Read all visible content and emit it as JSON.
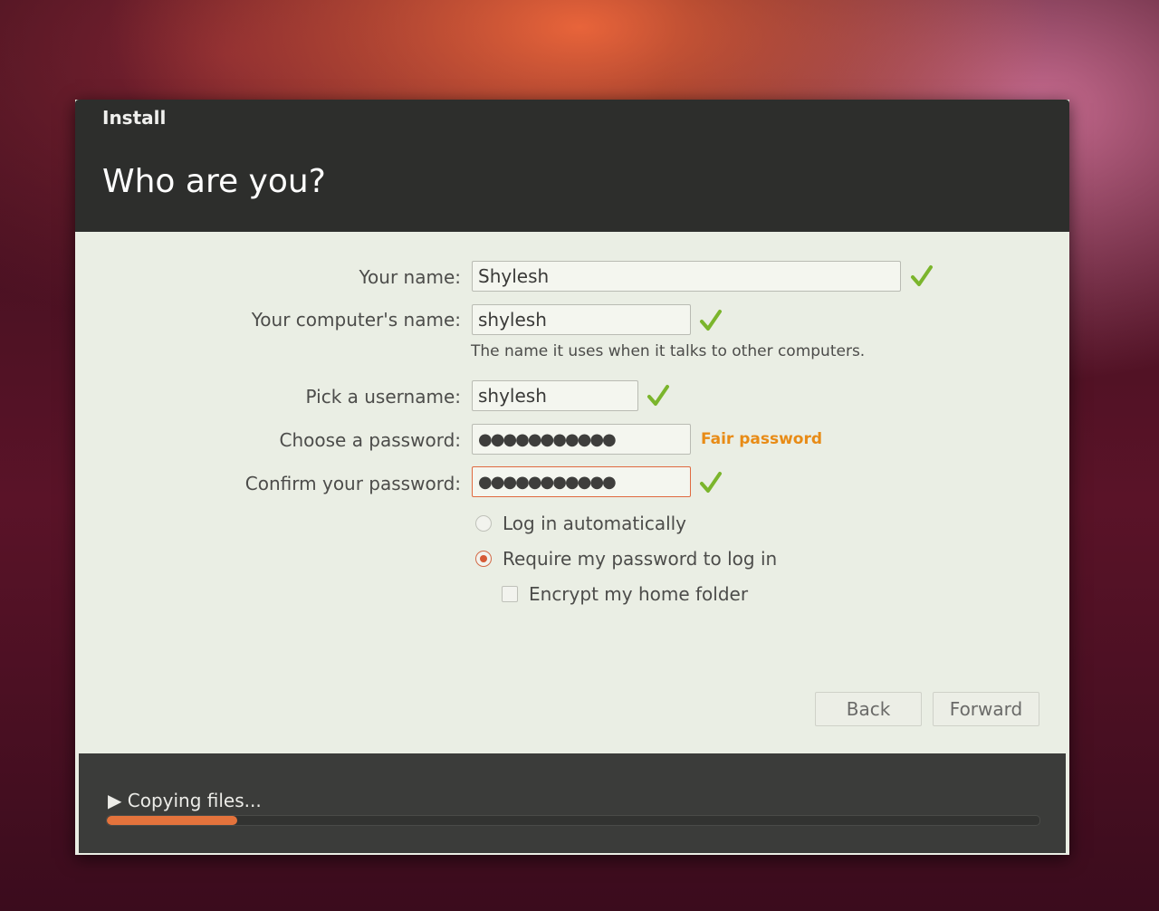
{
  "window": {
    "title": "Install",
    "page_title": "Who are you?"
  },
  "form": {
    "name": {
      "label": "Your name:",
      "value": "Shylesh",
      "valid": true
    },
    "computer": {
      "label": "Your computer's name:",
      "value": "shylesh",
      "hint": "The name it uses when it talks to other computers.",
      "valid": true
    },
    "username": {
      "label": "Pick a username:",
      "value": "shylesh",
      "valid": true
    },
    "password": {
      "label": "Choose a password:",
      "value": "●●●●●●●●●●●",
      "strength": "Fair password"
    },
    "confirm": {
      "label": "Confirm your password:",
      "value": "●●●●●●●●●●●",
      "valid": true
    }
  },
  "login_options": {
    "auto": {
      "label": "Log in automatically",
      "selected": false
    },
    "require": {
      "label": "Require my password to log in",
      "selected": true
    },
    "encrypt": {
      "label": "Encrypt my home folder",
      "checked": false
    }
  },
  "buttons": {
    "back": "Back",
    "forward": "Forward"
  },
  "footer": {
    "status": "Copying files...",
    "progress": 0.14
  },
  "colors": {
    "accent": "#e4733c",
    "strength_fair": "#e88b16",
    "check": "#7bb52c"
  }
}
